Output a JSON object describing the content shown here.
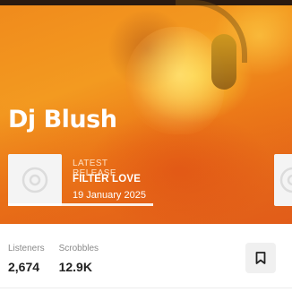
{
  "artist": {
    "name": "Dj Blush"
  },
  "latest_release": {
    "label": "LATEST RELEASE",
    "title": "FILTER LOVE",
    "date": "19 January 2025",
    "art_icon": "vinyl-disc-icon",
    "carousel_progress": 1.0
  },
  "stats": {
    "listeners": {
      "label": "Listeners",
      "value": "2,674"
    },
    "scrobbles": {
      "label": "Scrobbles",
      "value": "12.9K"
    }
  },
  "actions": {
    "bookmark_icon": "bookmark-icon"
  },
  "colors": {
    "hero_accent": "#f08a1c",
    "hero_warm": "#e1601c",
    "text_on_hero": "#ffffff"
  }
}
